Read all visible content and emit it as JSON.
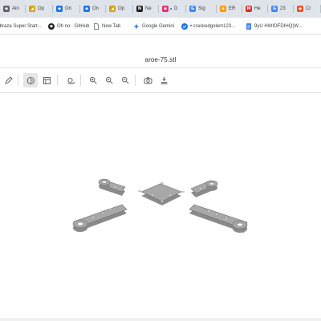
{
  "browser": {
    "tabs": [
      {
        "label": "Ain",
        "icon": "app-icon",
        "color": "#5f6368"
      },
      {
        "label": "Op",
        "icon": "onshape-icon",
        "color": "#d4a017"
      },
      {
        "label": "On",
        "icon": "app-icon",
        "color": "#1a73e8"
      },
      {
        "label": "On",
        "icon": "app-icon",
        "color": "#1a73e8"
      },
      {
        "label": "Op",
        "icon": "onshape-icon",
        "color": "#d4a017"
      },
      {
        "label": "Ne",
        "icon": "notion-icon",
        "color": "#202124"
      },
      {
        "label": "D",
        "icon": "opera-icon",
        "color": "#e1306c"
      },
      {
        "label": "Sig",
        "icon": "google-icon",
        "color": "#4285f4"
      },
      {
        "label": "ER",
        "icon": "amazon-icon",
        "color": "#ff9900"
      },
      {
        "label": "He",
        "icon": "gmail-icon",
        "color": "#d93025"
      },
      {
        "label": "23",
        "icon": "google-icon",
        "color": "#4285f4"
      },
      {
        "label": "Cr",
        "icon": "app-icon",
        "color": "#f4511e"
      }
    ],
    "bookmarks": [
      {
        "label": "Ibraza Super Start...",
        "icon": "folder-icon"
      },
      {
        "label": "Oh no · GitHub",
        "icon": "github-icon"
      },
      {
        "label": "New Tab",
        "icon": "page-icon"
      },
      {
        "label": "Google Gemini",
        "icon": "gemini-icon"
      },
      {
        "label": "• crackedgolem123...",
        "icon": "app-icon"
      },
      {
        "label": "9yU HWIOFDIHQ(W...",
        "icon": "docs-icon"
      }
    ]
  },
  "viewer": {
    "file_name": "aroe-75.stl",
    "toolbar": [
      {
        "name": "edit-icon",
        "active": false
      },
      {
        "name": "shaded-view-icon",
        "active": true
      },
      {
        "name": "grid-view-icon",
        "active": false
      },
      {
        "name": "orbit-icon",
        "active": false
      },
      {
        "name": "zoom-in-icon",
        "active": false
      },
      {
        "name": "zoom-fit-icon",
        "active": false
      },
      {
        "name": "zoom-out-icon",
        "active": false
      },
      {
        "name": "camera-icon",
        "active": false
      },
      {
        "name": "measure-icon",
        "active": false
      }
    ]
  },
  "colors": {
    "tabstrip": "#dfe4ea",
    "model_top": "#a8a8a8",
    "model_side": "#8a8a8a",
    "model_edge": "#6f6f6f"
  }
}
